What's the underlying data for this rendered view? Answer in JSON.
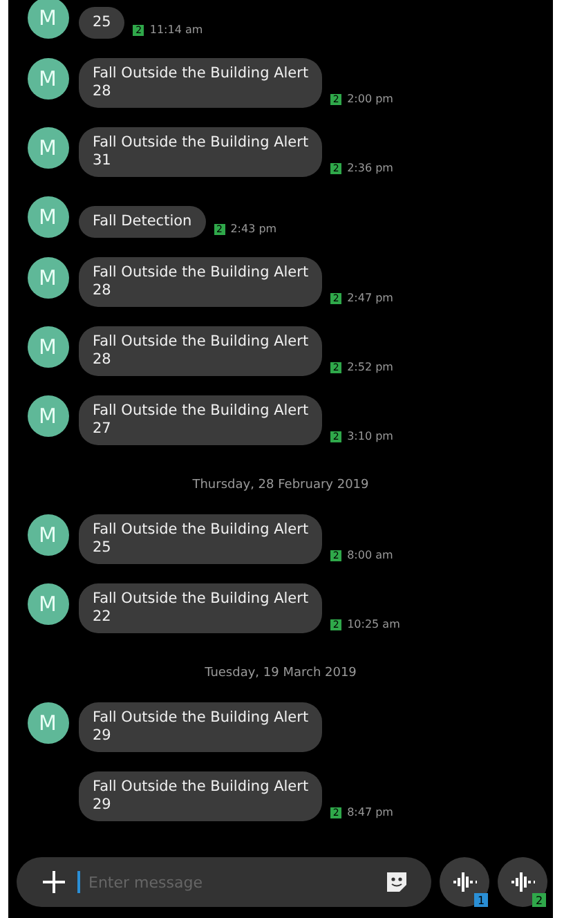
{
  "messages": [
    {
      "kind": "message",
      "avatar": "M",
      "lines": [
        "25"
      ],
      "sim": "2",
      "time": "11:14 am"
    },
    {
      "kind": "message",
      "avatar": "M",
      "lines": [
        "Fall Outside the Building Alert",
        "28"
      ],
      "sim": "2",
      "time": "2:00 pm"
    },
    {
      "kind": "message",
      "avatar": "M",
      "lines": [
        "Fall Outside the Building Alert",
        "31"
      ],
      "sim": "2",
      "time": "2:36 pm"
    },
    {
      "kind": "message",
      "avatar": "M",
      "lines": [
        "Fall Detection"
      ],
      "sim": "2",
      "time": "2:43 pm"
    },
    {
      "kind": "message",
      "avatar": "M",
      "lines": [
        "Fall Outside the Building Alert",
        "28"
      ],
      "sim": "2",
      "time": "2:47 pm"
    },
    {
      "kind": "message",
      "avatar": "M",
      "lines": [
        "Fall Outside the Building Alert",
        "28"
      ],
      "sim": "2",
      "time": "2:52 pm"
    },
    {
      "kind": "message",
      "avatar": "M",
      "lines": [
        "Fall Outside the Building Alert",
        "27"
      ],
      "sim": "2",
      "time": "3:10 pm"
    },
    {
      "kind": "date",
      "text": "Thursday, 28 February 2019"
    },
    {
      "kind": "message",
      "avatar": "M",
      "lines": [
        "Fall Outside the Building Alert",
        "25"
      ],
      "sim": "2",
      "time": "8:00 am"
    },
    {
      "kind": "message",
      "avatar": "M",
      "lines": [
        "Fall Outside the Building Alert",
        "22"
      ],
      "sim": "2",
      "time": "10:25 am"
    },
    {
      "kind": "date",
      "text": "Tuesday, 19 March 2019"
    },
    {
      "kind": "message",
      "avatar": "M",
      "lines": [
        "Fall Outside the Building Alert",
        "29"
      ]
    },
    {
      "kind": "message",
      "lines": [
        "Fall Outside the Building Alert",
        "29"
      ],
      "sim": "2",
      "time": "8:47 pm"
    }
  ],
  "composer": {
    "placeholder": "Enter message",
    "send_buttons": [
      {
        "sim": "1",
        "color": "#2a8fd6"
      },
      {
        "sim": "2",
        "color": "#2fa84a"
      }
    ]
  }
}
